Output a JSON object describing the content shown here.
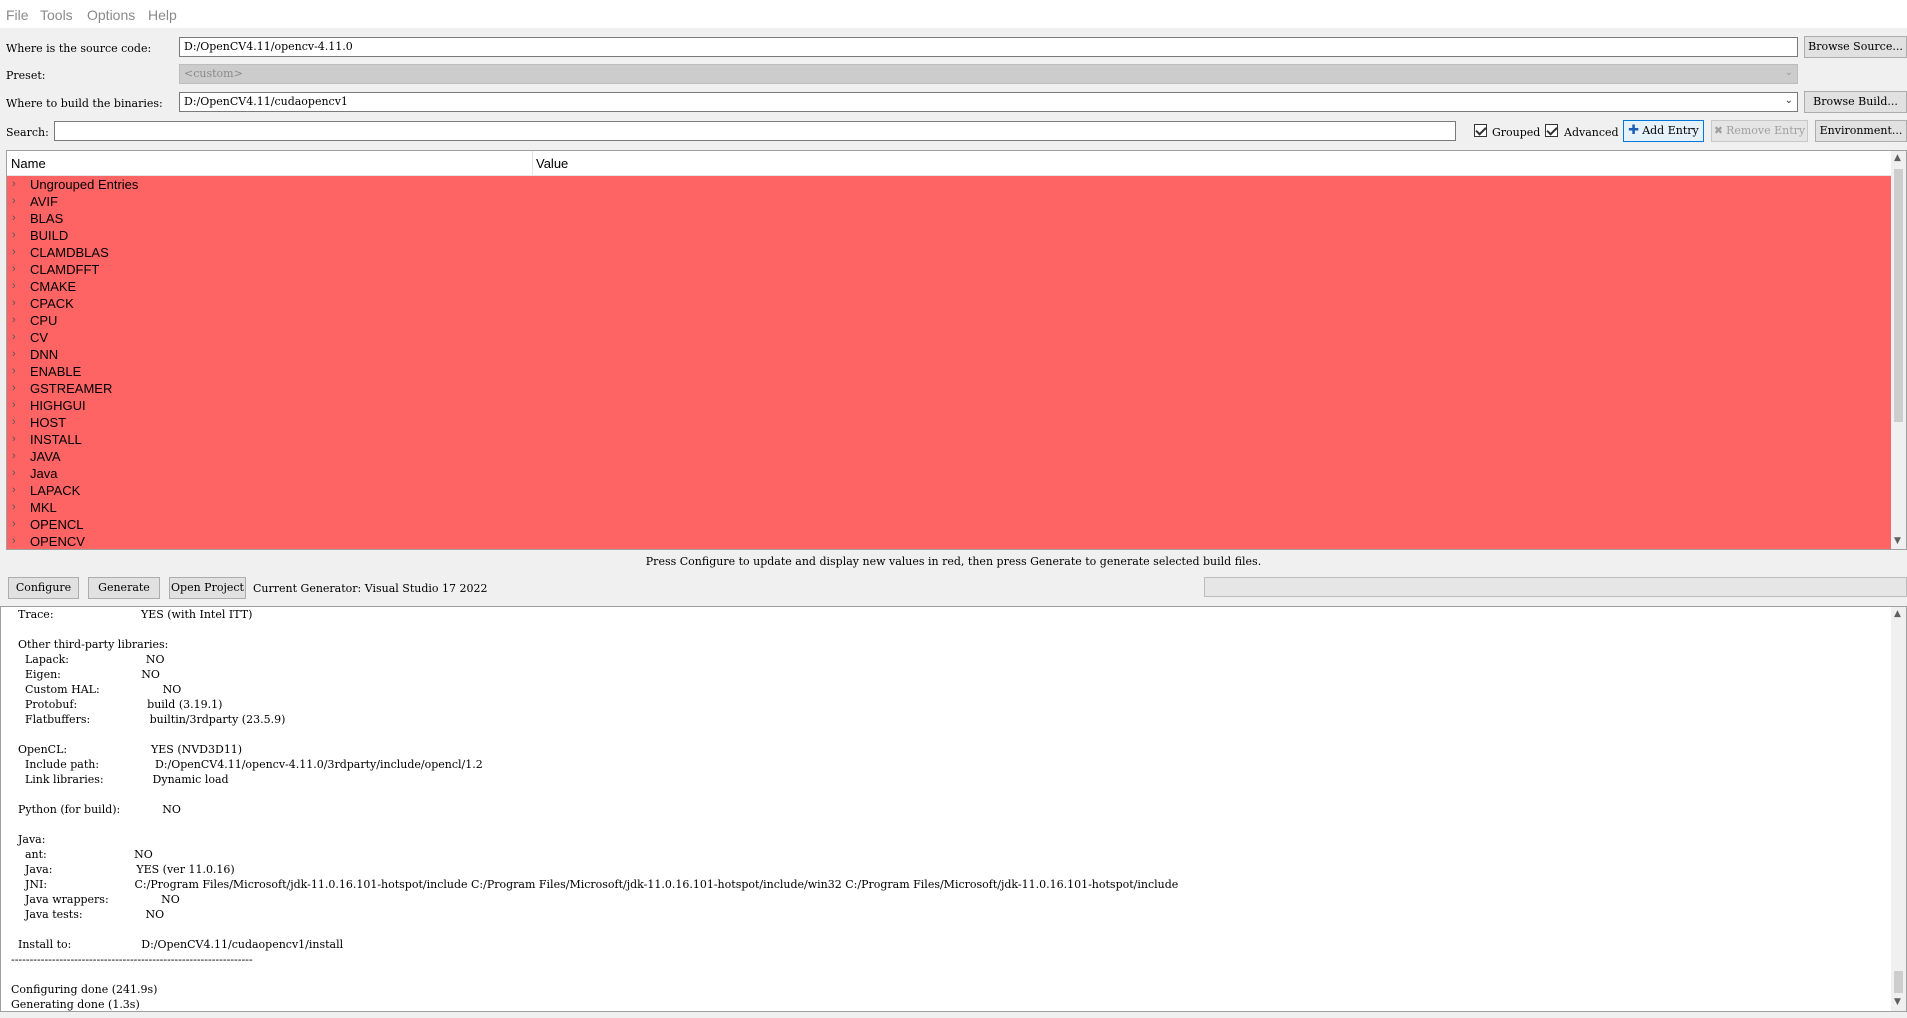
{
  "menu": [
    "File",
    "Tools",
    "Options",
    "Help"
  ],
  "source": {
    "label": "Where is the source code:",
    "value": "D:/OpenCV4.11/opencv-4.11.0",
    "browse": "Browse Source..."
  },
  "preset": {
    "label": "Preset:",
    "value": "<custom>"
  },
  "build": {
    "label": "Where to build the binaries:",
    "value": "D:/OpenCV4.11/cudaopencv1",
    "browse": "Browse Build..."
  },
  "search": {
    "label": "Search:",
    "value": ""
  },
  "options": {
    "grouped": {
      "label": "Grouped",
      "checked": true
    },
    "advanced": {
      "label": "Advanced",
      "checked": true
    },
    "add_entry": "Add Entry",
    "remove_entry": "Remove Entry",
    "environment": "Environment..."
  },
  "tree": {
    "columns": {
      "name": "Name",
      "value": "Value"
    },
    "highlight_color": "#ff6464",
    "rows": [
      "Ungrouped Entries",
      "AVIF",
      "BLAS",
      "BUILD",
      "CLAMDBLAS",
      "CLAMDFFT",
      "CMAKE",
      "CPACK",
      "CPU",
      "CV",
      "DNN",
      "ENABLE",
      "GSTREAMER",
      "HIGHGUI",
      "HOST",
      "INSTALL",
      "JAVA",
      "Java",
      "LAPACK",
      "MKL",
      "OPENCL",
      "OPENCV"
    ]
  },
  "hint": "Press Configure to update and display new values in red, then press Generate to generate selected build files.",
  "actions": {
    "configure": "Configure",
    "generate": "Generate",
    "open_project": "Open Project",
    "generator": "Current Generator: Visual Studio 17 2022"
  },
  "log": [
    "  Trace:                         YES (with Intel ITT)",
    "",
    "  Other third-party libraries:",
    "    Lapack:                      NO",
    "    Eigen:                       NO",
    "    Custom HAL:                  NO",
    "    Protobuf:                    build (3.19.1)",
    "    Flatbuffers:                 builtin/3rdparty (23.5.9)",
    "",
    "  OpenCL:                        YES (NVD3D11)",
    "    Include path:                D:/OpenCV4.11/opencv-4.11.0/3rdparty/include/opencl/1.2",
    "    Link libraries:              Dynamic load",
    "",
    "  Python (for build):            NO",
    "",
    "  Java:",
    "    ant:                         NO",
    "    Java:                        YES (ver 11.0.16)",
    "    JNI:                         C:/Program Files/Microsoft/jdk-11.0.16.101-hotspot/include C:/Program Files/Microsoft/jdk-11.0.16.101-hotspot/include/win32 C:/Program Files/Microsoft/jdk-11.0.16.101-hotspot/include",
    "    Java wrappers:               NO",
    "    Java tests:                  NO",
    "",
    "  Install to:                    D:/OpenCV4.11/cudaopencv1/install",
    "-----------------------------------------------------------------",
    "",
    "Configuring done (241.9s)",
    "Generating done (1.3s)"
  ]
}
